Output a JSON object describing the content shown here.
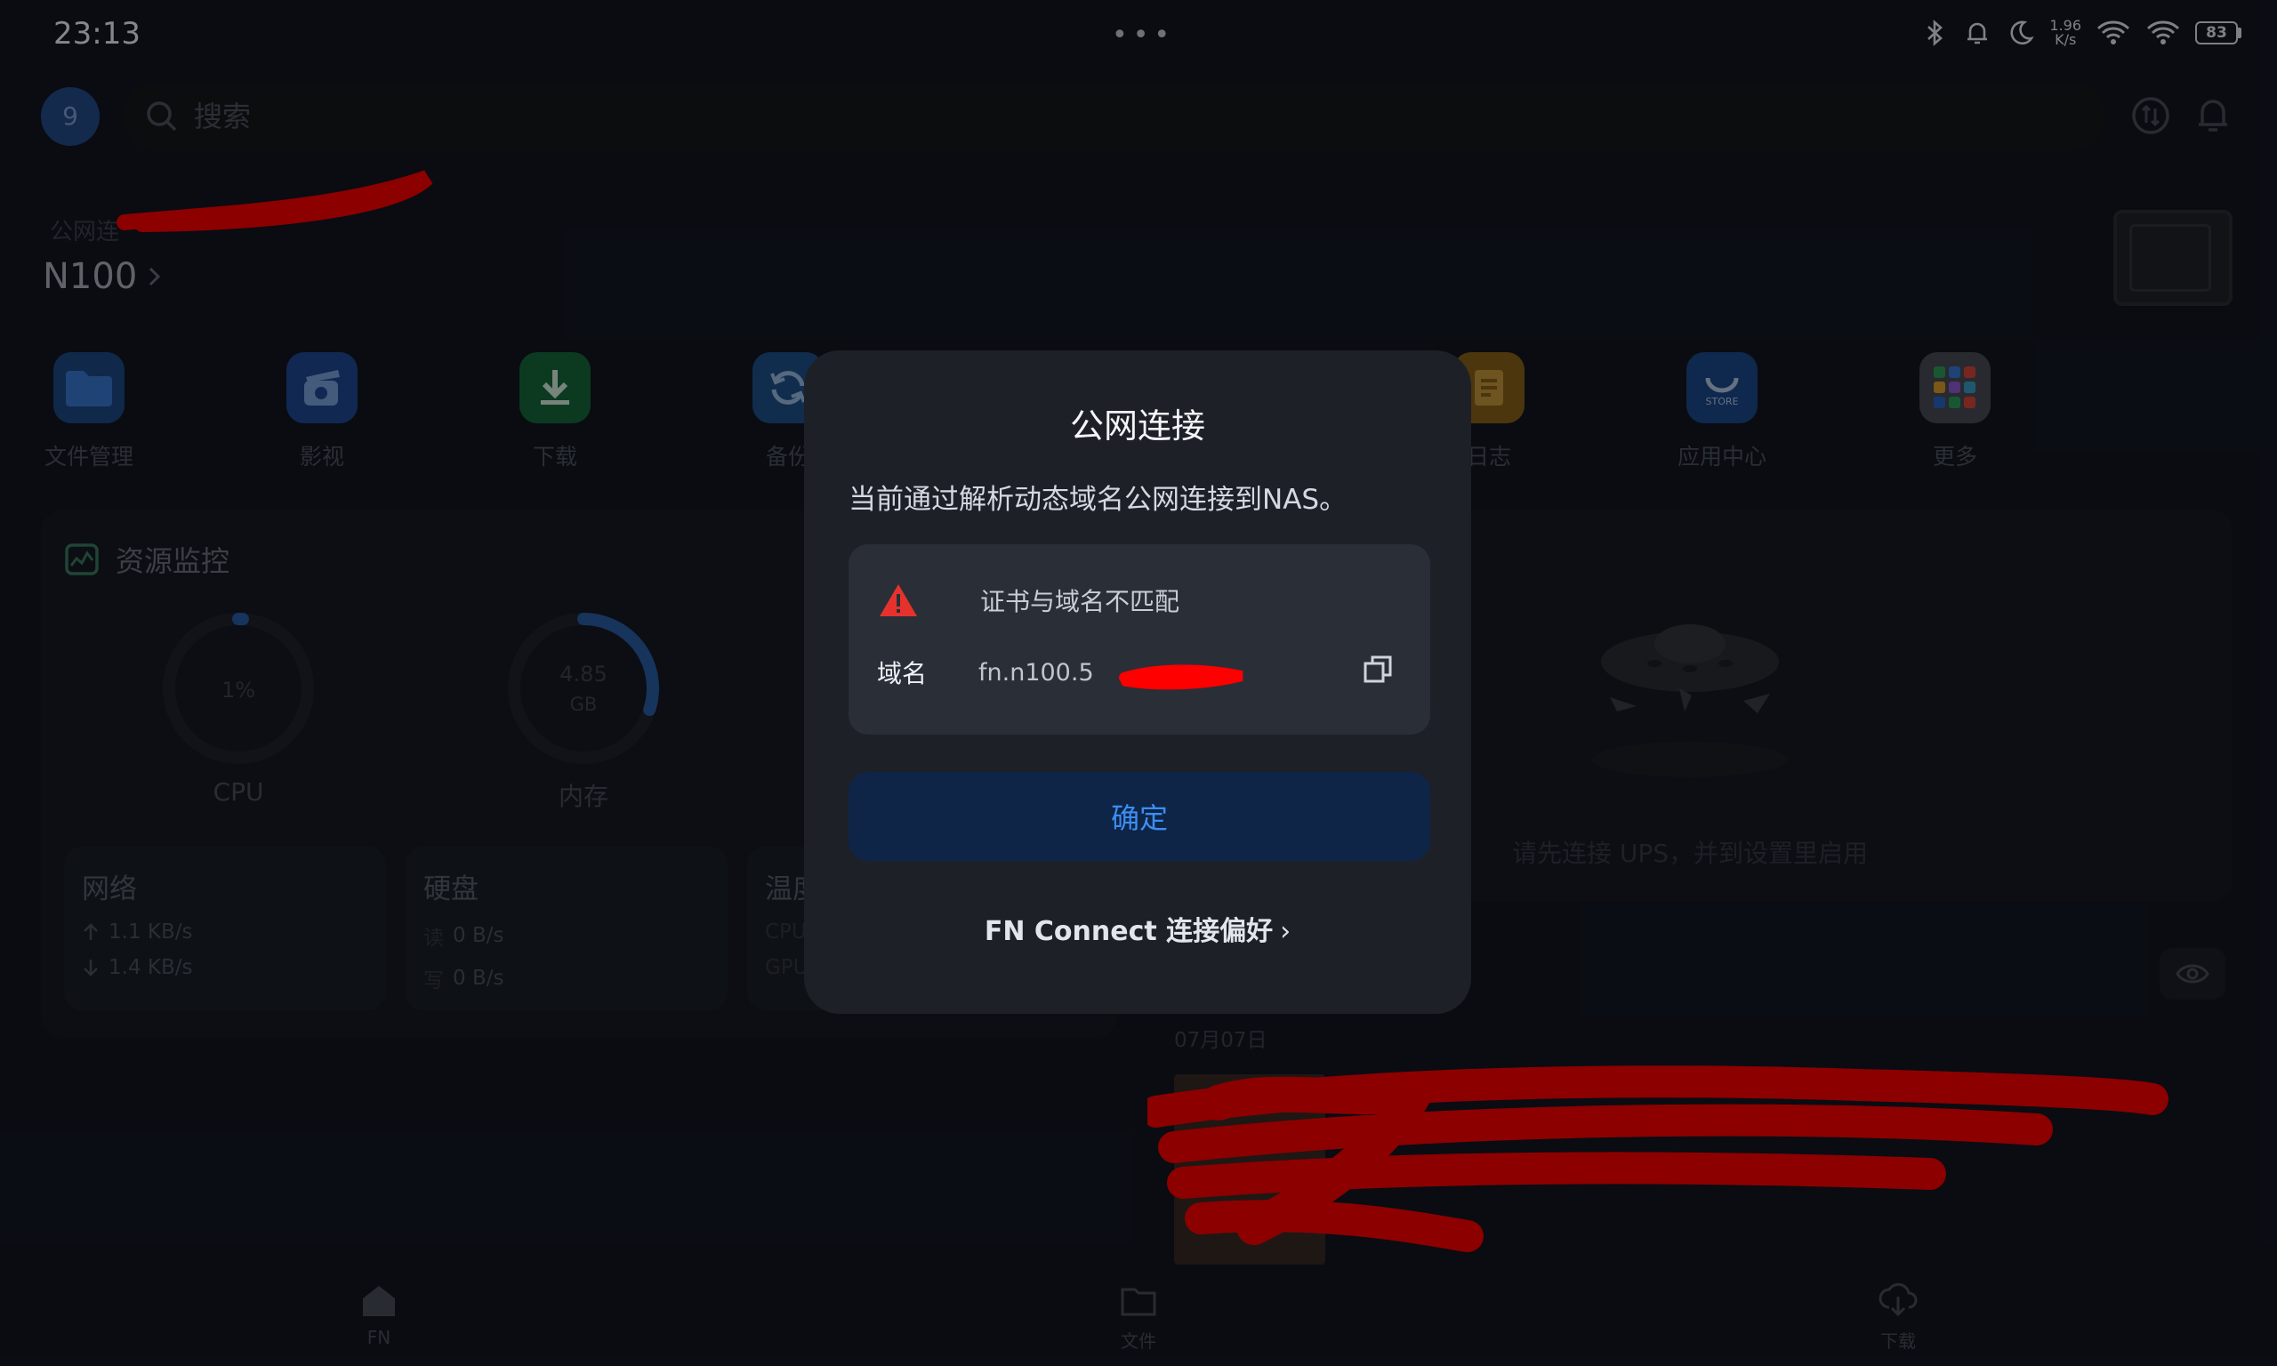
{
  "status_bar": {
    "time": "23:13",
    "dots": "•••",
    "speed_value": "1.96",
    "speed_unit": "K/s",
    "battery": "83",
    "icons": [
      "bluetooth-icon",
      "bell-icon",
      "moon-icon",
      "wifi-icon",
      "signal-icon",
      "battery-icon"
    ]
  },
  "header": {
    "avatar": "9",
    "search_placeholder": "搜索",
    "connection_label": "公网连",
    "device_name": "N100"
  },
  "apps": [
    {
      "label": "文件管理",
      "color": "#3a7bd5",
      "icon": "folder-icon"
    },
    {
      "label": "影视",
      "color": "#2f6fd1",
      "icon": "clapper-icon"
    },
    {
      "label": "下载",
      "color": "#1f9d55",
      "icon": "download-icon"
    },
    {
      "label": "备份",
      "color": "#2b7bd6",
      "icon": "sync-icon"
    },
    {
      "label": "日志",
      "color": "#e0a12b",
      "icon": "log-icon"
    },
    {
      "label": "应用中心",
      "color": "#2a67c9",
      "icon": "store-icon"
    },
    {
      "label": "更多",
      "color": "#5a5f6b",
      "icon": "grid-icon"
    }
  ],
  "monitor": {
    "title": "资源监控",
    "cpu": {
      "value": "1%",
      "label": "CPU",
      "level": 0.01
    },
    "memory": {
      "value": "4.85",
      "unit": "GB",
      "label": "内存",
      "level": 0.3
    },
    "network": {
      "title": "网络",
      "up": "1.1 KB/s",
      "down": "1.4 KB/s"
    },
    "disk": {
      "title": "硬盘",
      "read_label": "读",
      "read": "0 B/s",
      "write_label": "写",
      "write": "0 B/s"
    },
    "temp": {
      "title": "温度",
      "cpu_label": "CPU",
      "gpu_label": "GPU"
    }
  },
  "ups": {
    "message": "请先连接 UPS，并到设置里启用"
  },
  "photos": {
    "date": "07月07日"
  },
  "bottom_nav": [
    {
      "label": "FN",
      "icon": "home-icon"
    },
    {
      "label": "文件",
      "icon": "folder-icon"
    },
    {
      "label": "下载",
      "icon": "download-icon"
    }
  ],
  "modal": {
    "title": "公网连接",
    "description": "当前通过解析动态域名公网连接到NAS。",
    "warning": "证书与域名不匹配",
    "domain_label": "域名",
    "domain_value": "fn.n100.5",
    "confirm": "确定",
    "preferences_link": "FN Connect 连接偏好",
    "warning_color": "#e5322d",
    "accent_color": "#3d8df2"
  }
}
